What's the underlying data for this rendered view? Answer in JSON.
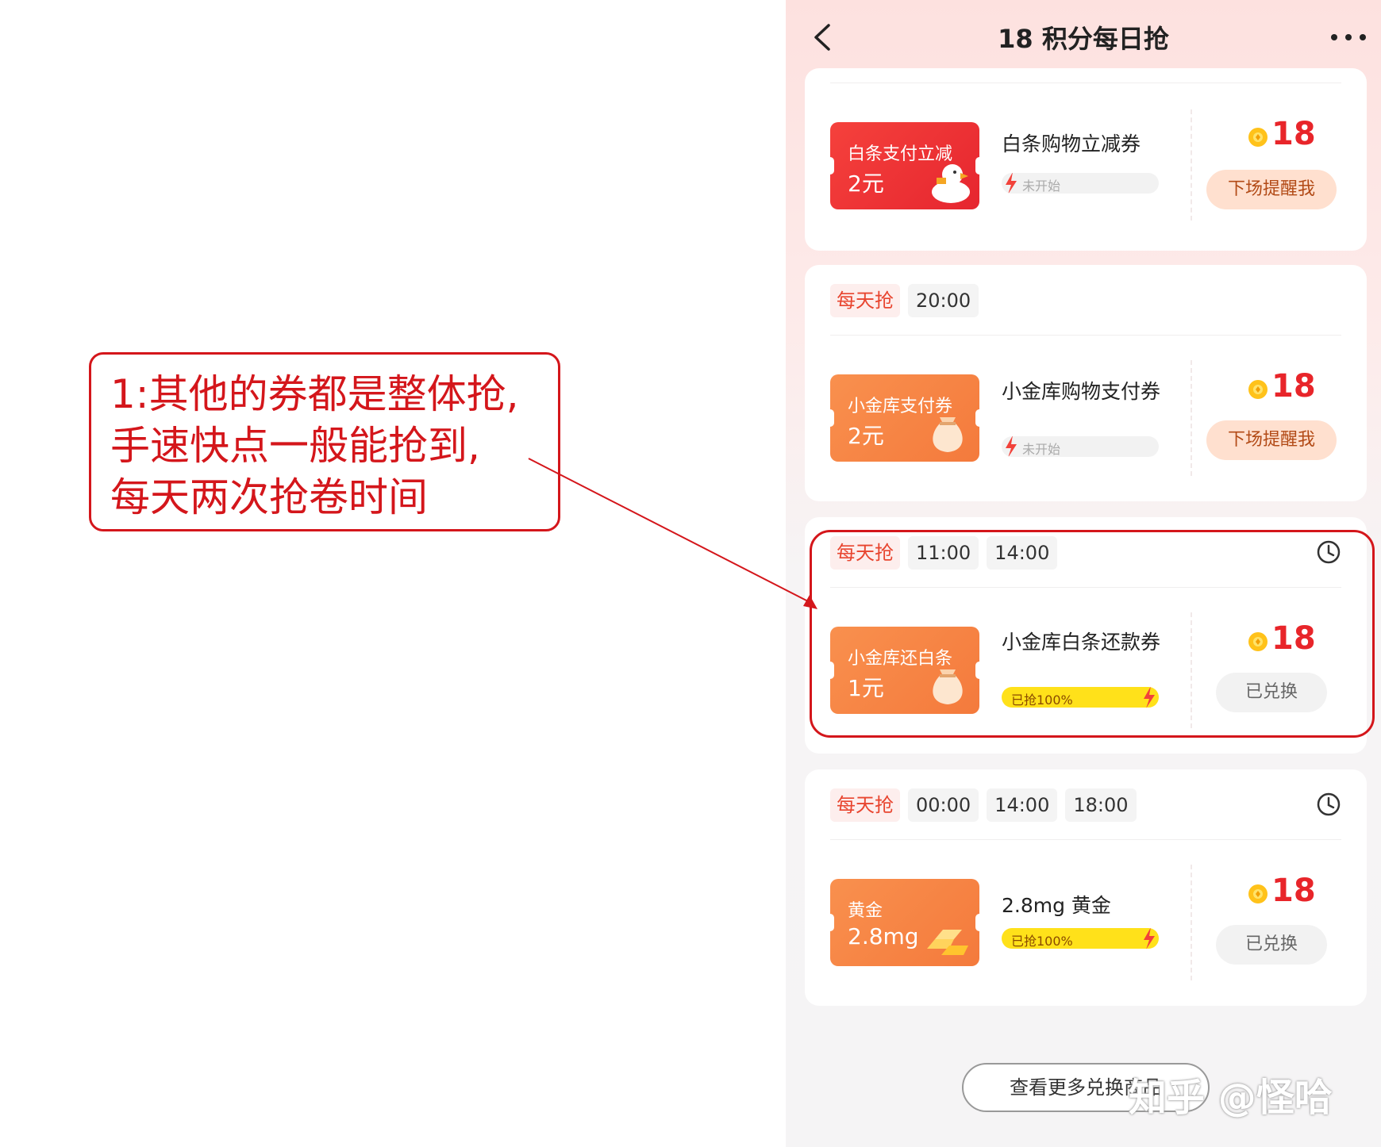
{
  "annotation": {
    "lines": [
      "1:其他的券都是整体抢,",
      "手速快点一般能抢到,",
      "每天两次抢卷时间"
    ]
  },
  "header": {
    "title": "18 积分每日抢"
  },
  "cards": [
    {
      "coupon_line1": "白条支付立减",
      "coupon_line2": "2元",
      "coupon_icon": "duck-mascot-icon",
      "title": "白条购物立减券",
      "status": "未开始",
      "price": "18",
      "button": "下场提醒我"
    },
    {
      "tag": "每天抢",
      "times": [
        "20:00"
      ],
      "coupon_line1": "小金库支付券",
      "coupon_line2": "2元",
      "coupon_icon": "money-bag-icon",
      "title": "小金库购物支付券",
      "status": "未开始",
      "price": "18",
      "button": "下场提醒我"
    },
    {
      "tag": "每天抢",
      "times": [
        "11:00",
        "14:00"
      ],
      "coupon_line1": "小金库还白条",
      "coupon_line2": "1元",
      "coupon_icon": "money-bag-icon",
      "title": "小金库白条还款券",
      "status": "已抢100%",
      "progress": 1.0,
      "price": "18",
      "button": "已兑换"
    },
    {
      "tag": "每天抢",
      "times": [
        "00:00",
        "14:00",
        "18:00"
      ],
      "coupon_line1": "黄金",
      "coupon_line2": "2.8mg",
      "coupon_icon": "gold-bars-icon",
      "title": "2.8mg 黄金",
      "status": "已抢100%",
      "progress": 1.0,
      "price": "18",
      "button": "已兑换"
    }
  ],
  "footer": {
    "more_button": "查看更多兑换商品"
  },
  "watermark": "知乎 @怪哈",
  "colors": {
    "accent": "#e8252a",
    "annotation": "#d4161b",
    "progress": "#ffe11a"
  }
}
